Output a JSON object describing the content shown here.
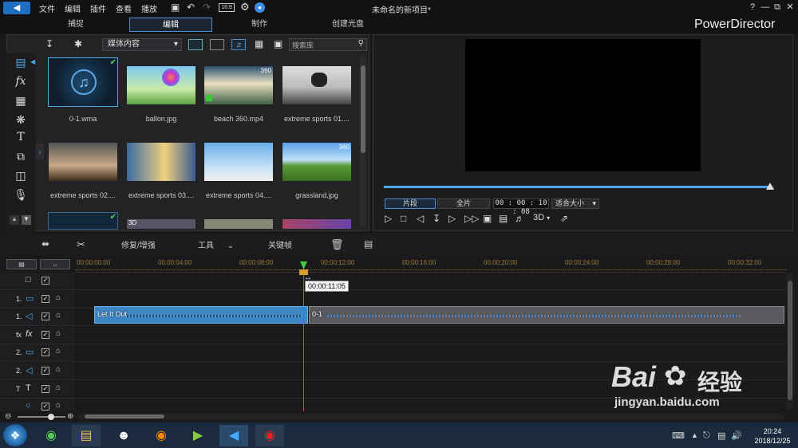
{
  "titlebar": {
    "menus": [
      "文件",
      "编辑",
      "插件",
      "查看",
      "播放"
    ],
    "project_title": "未命名的新项目*",
    "window_controls": [
      "?",
      "—",
      "⧉",
      "✕"
    ]
  },
  "modes": {
    "tabs": [
      "捕捉",
      "编辑",
      "制作",
      "创建光盘"
    ],
    "active": "编辑",
    "brand": "PowerDirector"
  },
  "library": {
    "filter_select": "媒体内容",
    "search_placeholder": "搜索库",
    "items": [
      {
        "label": "0-1.wma",
        "badge": ""
      },
      {
        "label": "ballon.jpg",
        "badge": ""
      },
      {
        "label": "beach 360.mp4",
        "badge": "360"
      },
      {
        "label": "extreme sports 01....",
        "badge": ""
      },
      {
        "label": "extreme sports 02....",
        "badge": ""
      },
      {
        "label": "extreme sports 03....",
        "badge": ""
      },
      {
        "label": "extreme sports 04....",
        "badge": ""
      },
      {
        "label": "grassland.jpg",
        "badge": "360"
      }
    ],
    "row3_badge": "3D"
  },
  "preview": {
    "mode_clip": "片段",
    "mode_full": "全片",
    "timecode": "00 : 00 : 10 : 08",
    "zoom": "适合大小",
    "view_3d": "3D",
    "seek_progress": 0.99
  },
  "timeline_tools": {
    "fix_enhance": "修复/增强",
    "tools": "工具",
    "keyframe": "关键帧"
  },
  "ruler": {
    "ticks": [
      "00:00:00:00",
      "00:00:04:00",
      "00:00:08:00",
      "00:00:12:00",
      "00:00:16:00",
      "00:00:20:00",
      "00:00:24:00",
      "00:00:28:00",
      "00:00:32:00"
    ]
  },
  "tracks": [
    {
      "label": "",
      "kind": "overlay"
    },
    {
      "label": "1.",
      "kind": "video"
    },
    {
      "label": "1.",
      "kind": "audio"
    },
    {
      "label": "fx",
      "kind": "fx"
    },
    {
      "label": "2.",
      "kind": "video"
    },
    {
      "label": "2.",
      "kind": "audio"
    },
    {
      "label": "T",
      "kind": "title"
    },
    {
      "label": "",
      "kind": "voice"
    }
  ],
  "clips": {
    "clip1": "Let It Out",
    "clip2": "0-1"
  },
  "playhead": {
    "tooltip": "00:00:11:05"
  },
  "taskbar": {
    "time": "20:24",
    "date": "2018/12/25"
  },
  "watermark": {
    "brand": "Bai",
    "brand2": "经验",
    "url": "jingyan.baidu.com"
  }
}
